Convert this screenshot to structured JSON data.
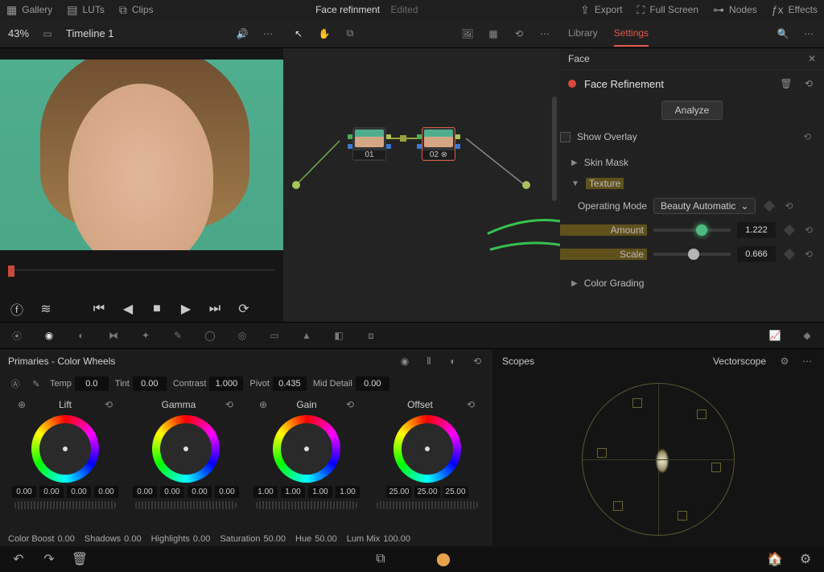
{
  "topbar": {
    "gallery": "Gallery",
    "luts": "LUTs",
    "clips": "Clips",
    "title": "Face refinment",
    "status": "Edited",
    "export": "Export",
    "fullscreen": "Full Screen",
    "nodes": "Nodes",
    "effects": "Effects"
  },
  "secondbar": {
    "zoom": "43%",
    "timeline": "Timeline 1",
    "tabs": {
      "library": "Library",
      "settings": "Settings"
    }
  },
  "nodes": {
    "n1": {
      "label": "01"
    },
    "n2": {
      "label": "02"
    }
  },
  "inspector": {
    "search_value": "Face",
    "fx_name": "Face Refinement",
    "analyze": "Analyze",
    "show_overlay": "Show Overlay",
    "sections": {
      "skin_mask": "Skin Mask",
      "texture": "Texture",
      "color_grading": "Color Grading"
    },
    "operating_mode_label": "Operating Mode",
    "operating_mode_value": "Beauty Automatic",
    "amount_label": "Amount",
    "amount_value": "1.222",
    "scale_label": "Scale",
    "scale_value": "0.666"
  },
  "wheels": {
    "title": "Primaries - Color Wheels",
    "temp_label": "Temp",
    "temp_value": "0.0",
    "tint_label": "Tint",
    "tint_value": "0.00",
    "contrast_label": "Contrast",
    "contrast_value": "1.000",
    "pivot_label": "Pivot",
    "pivot_value": "0.435",
    "middetail_label": "Mid Detail",
    "middetail_value": "0.00",
    "lift": {
      "name": "Lift",
      "vals": [
        "0.00",
        "0.00",
        "0.00",
        "0.00"
      ]
    },
    "gamma": {
      "name": "Gamma",
      "vals": [
        "0.00",
        "0.00",
        "0.00",
        "0.00"
      ]
    },
    "gain": {
      "name": "Gain",
      "vals": [
        "1.00",
        "1.00",
        "1.00",
        "1.00"
      ]
    },
    "offset": {
      "name": "Offset",
      "vals": [
        "25.00",
        "25.00",
        "25.00"
      ]
    },
    "colorboost_label": "Color Boost",
    "colorboost_value": "0.00",
    "shadows_label": "Shadows",
    "shadows_value": "0.00",
    "highlights_label": "Highlights",
    "highlights_value": "0.00",
    "saturation_label": "Saturation",
    "saturation_value": "50.00",
    "hue_label": "Hue",
    "hue_value": "50.00",
    "lummix_label": "Lum Mix",
    "lummix_value": "100.00"
  },
  "scopes": {
    "title": "Scopes",
    "mode": "Vectorscope"
  }
}
